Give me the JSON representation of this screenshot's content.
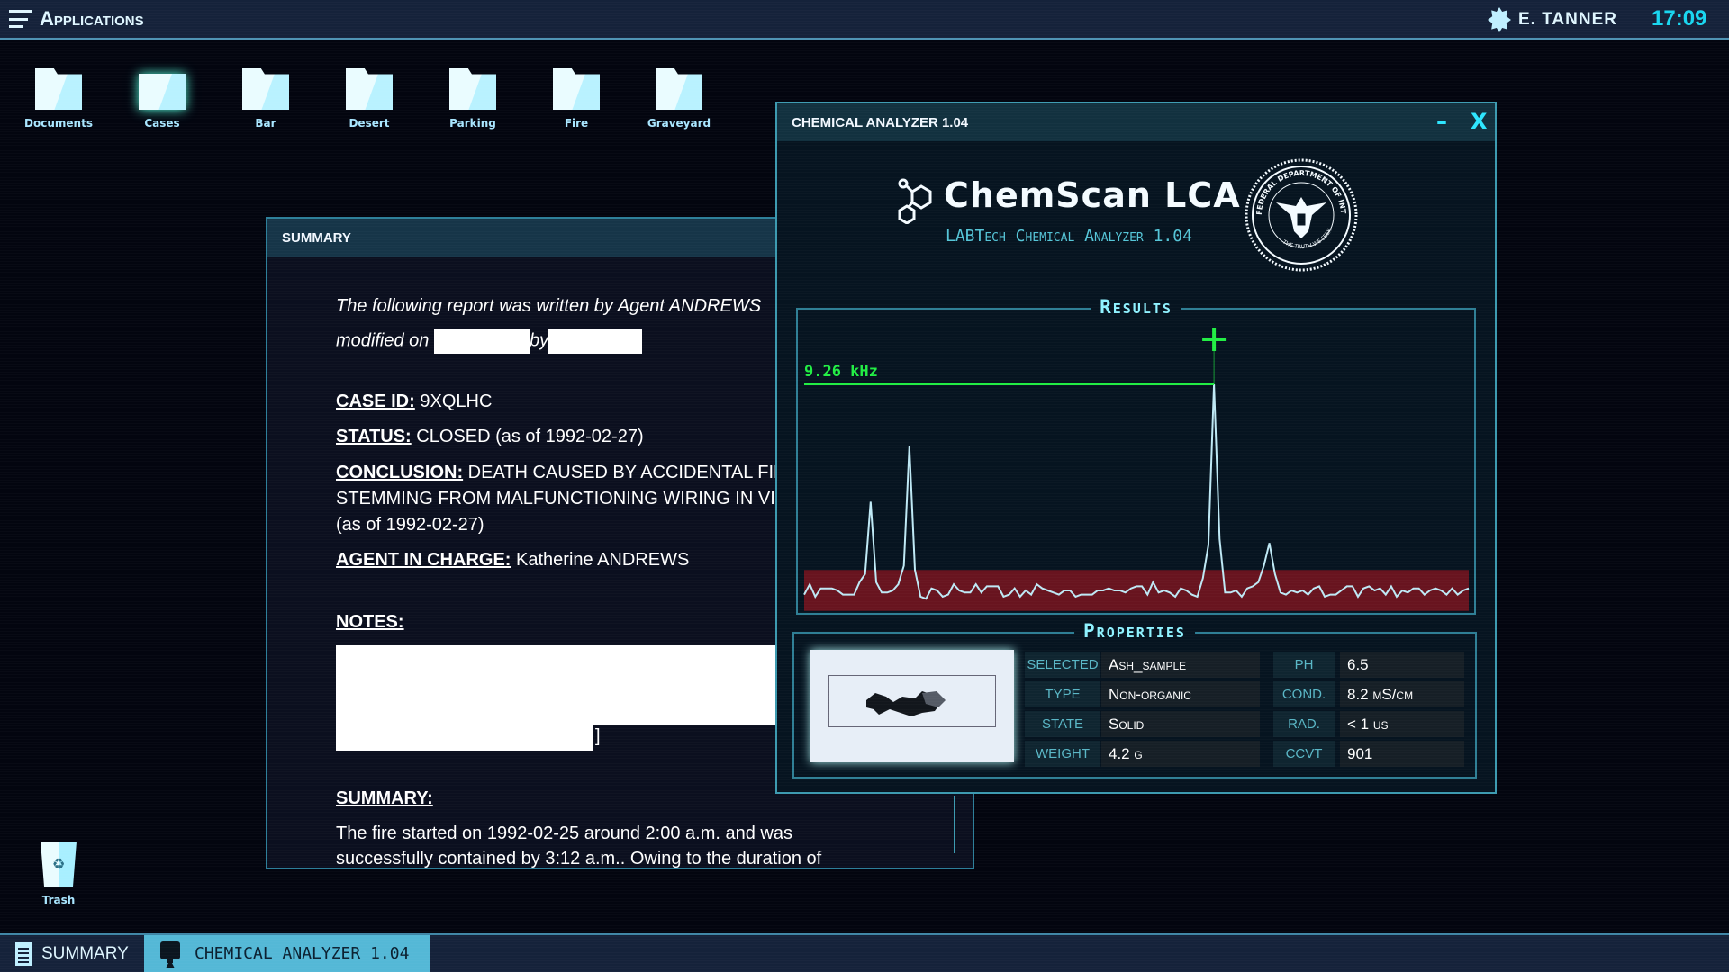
{
  "topbar": {
    "menu_label": "Applications",
    "user": "E. TANNER",
    "time": "17:09"
  },
  "desktop": {
    "icons": [
      {
        "label": "Documents",
        "icon": "documents-icon"
      },
      {
        "label": "Cases",
        "icon": "cases-icon"
      },
      {
        "label": "Bar",
        "icon": "folder-icon"
      },
      {
        "label": "Desert",
        "icon": "folder-icon"
      },
      {
        "label": "Parking",
        "icon": "folder-icon"
      },
      {
        "label": "Fire",
        "icon": "folder-icon"
      },
      {
        "label": "Graveyard",
        "icon": "folder-icon"
      }
    ],
    "trash_label": "Trash"
  },
  "summary_window": {
    "title": "SUMMARY",
    "intro_1": "The following report was written by Agent ANDREWS",
    "intro_2a": "modified on",
    "intro_2b": "by",
    "case_id_label": "CASE ID:",
    "case_id": "9XQLHC",
    "status_label": "STATUS:",
    "status": "CLOSED (as of 1992-02-27)",
    "conclusion_label": "CONCLUSION:",
    "conclusion_1": "DEATH CAUSED BY ACCIDENTAL FIR",
    "conclusion_2": "STEMMING FROM MALFUNCTIONING WIRING IN VICT",
    "conclusion_3": "(as of 1992-02-27)",
    "agent_label": "AGENT IN CHARGE:",
    "agent": "Katherine ANDREWS",
    "notes_label": "NOTES:",
    "notes_tail": "]",
    "summary_label": "SUMMARY:",
    "summary_1": "The fire started on 1992-02-25 around 2:00 a.m. and was",
    "summary_2": "successfully contained by 3:12 a.m.. Owing to the duration of"
  },
  "chem_window": {
    "title": "CHEMICAL ANALYZER 1.04",
    "minimize": "–",
    "close": "X",
    "app_name": "ChemScan LCA",
    "app_subtitle": "LABTech Chemical Analyzer 1.04",
    "seal_text_top": "FEDERAL DEPARTMENT OF INTELLIGENCE",
    "seal_text_bottom": "THE TRUTH WE SEEK",
    "results_title": "Results",
    "properties_title": "Properties",
    "properties": [
      {
        "label": "SELECTED",
        "value": "Ash_sample",
        "label2": "PH",
        "value2": "6.5"
      },
      {
        "label": "TYPE",
        "value": "Non-organic",
        "label2": "COND.",
        "value2": "8.2 mS/cm"
      },
      {
        "label": "STATE",
        "value": "Solid",
        "label2": "RAD.",
        "value2": "< 1 us"
      },
      {
        "label": "WEIGHT",
        "value": "4.2 g",
        "label2": "CCVT",
        "value2": "901"
      }
    ]
  },
  "chart_data": {
    "type": "line",
    "title": "",
    "xlabel": "",
    "ylabel": "",
    "ylim": [
      -10,
      100
    ],
    "grid": false,
    "line_color": "#bfe9f5",
    "marker_color": "#22ee44",
    "band_color": "#7a1420",
    "noise_band": [
      -6,
      6
    ],
    "peak_marker": {
      "index": 74,
      "label": "9.26 kHz"
    },
    "values": [
      -2,
      3,
      -3,
      1,
      1,
      1,
      0,
      -2,
      -2,
      -2,
      4,
      8,
      43,
      4,
      -1,
      -1,
      0,
      3,
      12,
      70,
      10,
      -3,
      -4,
      1,
      0,
      -3,
      -2,
      3,
      0,
      -1,
      -1,
      3,
      -1,
      2,
      2,
      2,
      -3,
      -2,
      1,
      -3,
      0,
      -2,
      3,
      1,
      0,
      -1,
      -2,
      0,
      0,
      -3,
      -2,
      -2,
      -2,
      0,
      0,
      1,
      0,
      0,
      -1,
      1,
      2,
      2,
      -2,
      4,
      -1,
      0,
      -1,
      -3,
      1,
      0,
      -2,
      -3,
      6,
      22,
      100,
      25,
      -1,
      -1,
      0,
      -3,
      1,
      2,
      4,
      12,
      23,
      8,
      -1,
      -2,
      0,
      -1,
      0,
      -2,
      1,
      2,
      -3,
      -2,
      -2,
      0,
      2,
      2,
      -3,
      1,
      2,
      0,
      1,
      -2,
      2,
      -3,
      0,
      -1,
      1,
      1,
      -2,
      0,
      1,
      0,
      -2,
      1,
      -2,
      0,
      1
    ]
  },
  "taskbar": {
    "tabs": [
      {
        "label": "SUMMARY"
      },
      {
        "label": "CHEMICAL ANALYZER 1.04"
      }
    ]
  }
}
